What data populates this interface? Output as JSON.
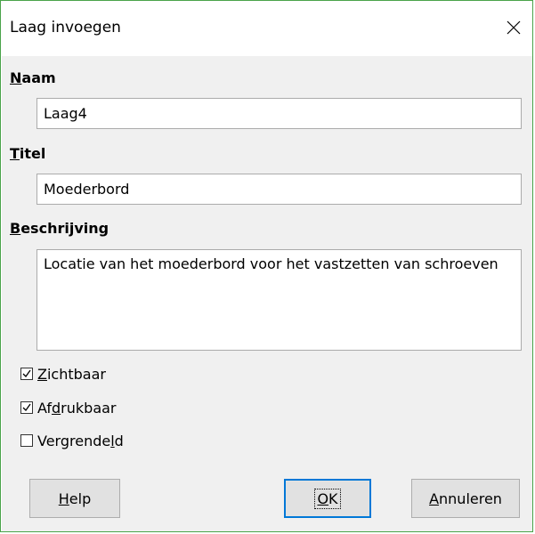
{
  "dialog": {
    "title": "Laag invoegen",
    "close_symbol": "✕"
  },
  "fields": {
    "name": {
      "label_accel": "N",
      "label_rest": "aam",
      "value": "Laag4"
    },
    "title": {
      "label_accel": "T",
      "label_rest": "itel",
      "value": "Moederbord"
    },
    "description": {
      "label_accel": "B",
      "label_rest": "eschrijving",
      "value": "Locatie van het moederbord voor het vastzetten van schroeven"
    }
  },
  "checkboxes": {
    "visible": {
      "pre": "",
      "accel": "Z",
      "post": "ichtbaar",
      "checked": true
    },
    "printable": {
      "pre": "Af",
      "accel": "d",
      "post": "rukbaar",
      "checked": true
    },
    "locked": {
      "pre": "Vergrende",
      "accel": "l",
      "post": "d",
      "checked": false
    }
  },
  "buttons": {
    "help": {
      "accel": "H",
      "post": "elp"
    },
    "ok": {
      "accel": "O",
      "post": "K"
    },
    "cancel": {
      "accel": "A",
      "post": "nnuleren"
    }
  },
  "icons": {
    "close": "close-icon",
    "checkmark": "checkmark-icon"
  },
  "colors": {
    "window_border": "#4aa34a",
    "default_button_border": "#0078d7",
    "panel_background": "#f0f0f0"
  }
}
